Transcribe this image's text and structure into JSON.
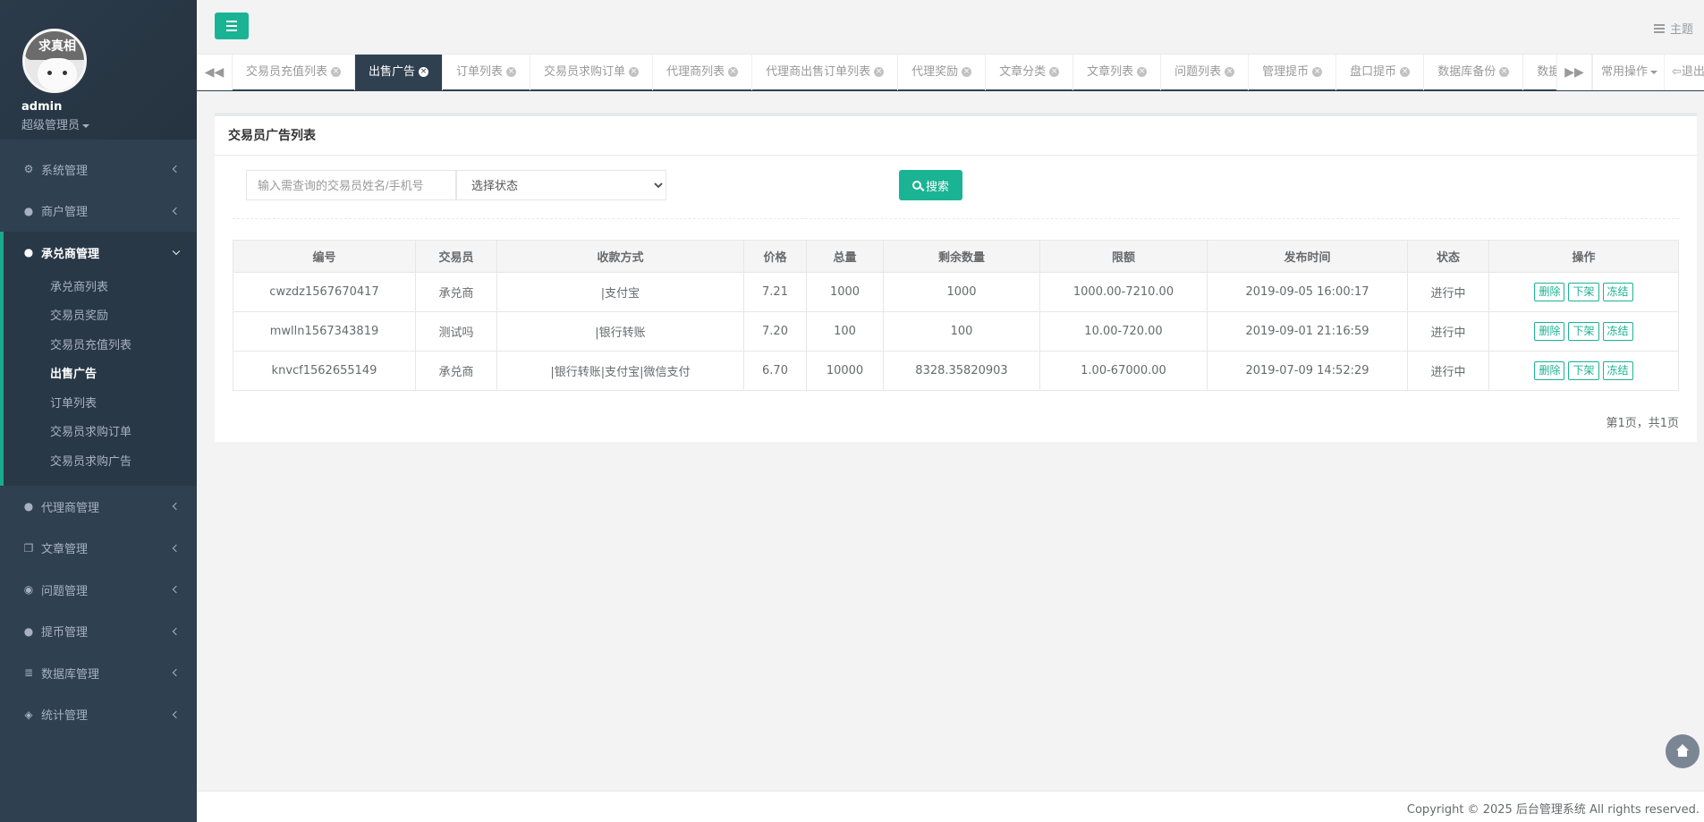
{
  "profile": {
    "avatar_text": "求真相",
    "username": "admin",
    "role": "超级管理员"
  },
  "sidebar": {
    "items": [
      {
        "label": "系统管理",
        "icon": "gear-icon"
      },
      {
        "label": "商户管理",
        "icon": "user-icon"
      },
      {
        "label": "承兑商管理",
        "icon": "user-icon",
        "active": true
      },
      {
        "label": "代理商管理",
        "icon": "user-icon"
      },
      {
        "label": "文章管理",
        "icon": "copy-icon"
      },
      {
        "label": "问题管理",
        "icon": "comment-icon"
      },
      {
        "label": "提币管理",
        "icon": "user-icon"
      },
      {
        "label": "数据库管理",
        "icon": "database-icon"
      },
      {
        "label": "统计管理",
        "icon": "cube-icon"
      }
    ],
    "subitems": [
      "承兑商列表",
      "交易员奖励",
      "交易员充值列表",
      "出售广告",
      "订单列表",
      "交易员求购订单",
      "交易员求购广告"
    ]
  },
  "header": {
    "theme_label": "主题"
  },
  "tabs": [
    "交易员充值列表",
    "出售广告",
    "订单列表",
    "交易员求购订单",
    "代理商列表",
    "代理商出售订单列表",
    "代理奖励",
    "文章分类",
    "文章列表",
    "问题列表",
    "管理提币",
    "盘口提币",
    "数据库备份",
    "数据"
  ],
  "tab_actions": {
    "common": "常用操作",
    "logout": "退出"
  },
  "panel": {
    "title": "交易员广告列表",
    "search_placeholder": "输入需查询的交易员姓名/手机号",
    "status_select": "选择状态",
    "search_button": "搜索",
    "pager": "第1页，共1页"
  },
  "table": {
    "headers": [
      "编号",
      "交易员",
      "收款方式",
      "价格",
      "总量",
      "剩余数量",
      "限额",
      "发布时间",
      "状态",
      "操作"
    ],
    "rows": [
      [
        "cwzdz1567670417",
        "承兑商",
        "|支付宝",
        "7.21",
        "1000",
        "1000",
        "1000.00-7210.00",
        "2019-09-05 16:00:17",
        "进行中"
      ],
      [
        "mwlln1567343819",
        "测试吗",
        "|银行转账",
        "7.20",
        "100",
        "100",
        "10.00-720.00",
        "2019-09-01 21:16:59",
        "进行中"
      ],
      [
        "knvcf1562655149",
        "承兑商",
        "|银行转账|支付宝|微信支付",
        "6.70",
        "10000",
        "8328.35820903",
        "1.00-67000.00",
        "2019-07-09 14:52:29",
        "进行中"
      ]
    ],
    "actions": [
      "删除",
      "下架",
      "冻结"
    ]
  },
  "footer": {
    "copyright": "Copyright © 2025 后台管理系统 All rights reserved."
  },
  "colors": {
    "sidebar": "#2f4050",
    "accent": "#1ab394"
  }
}
